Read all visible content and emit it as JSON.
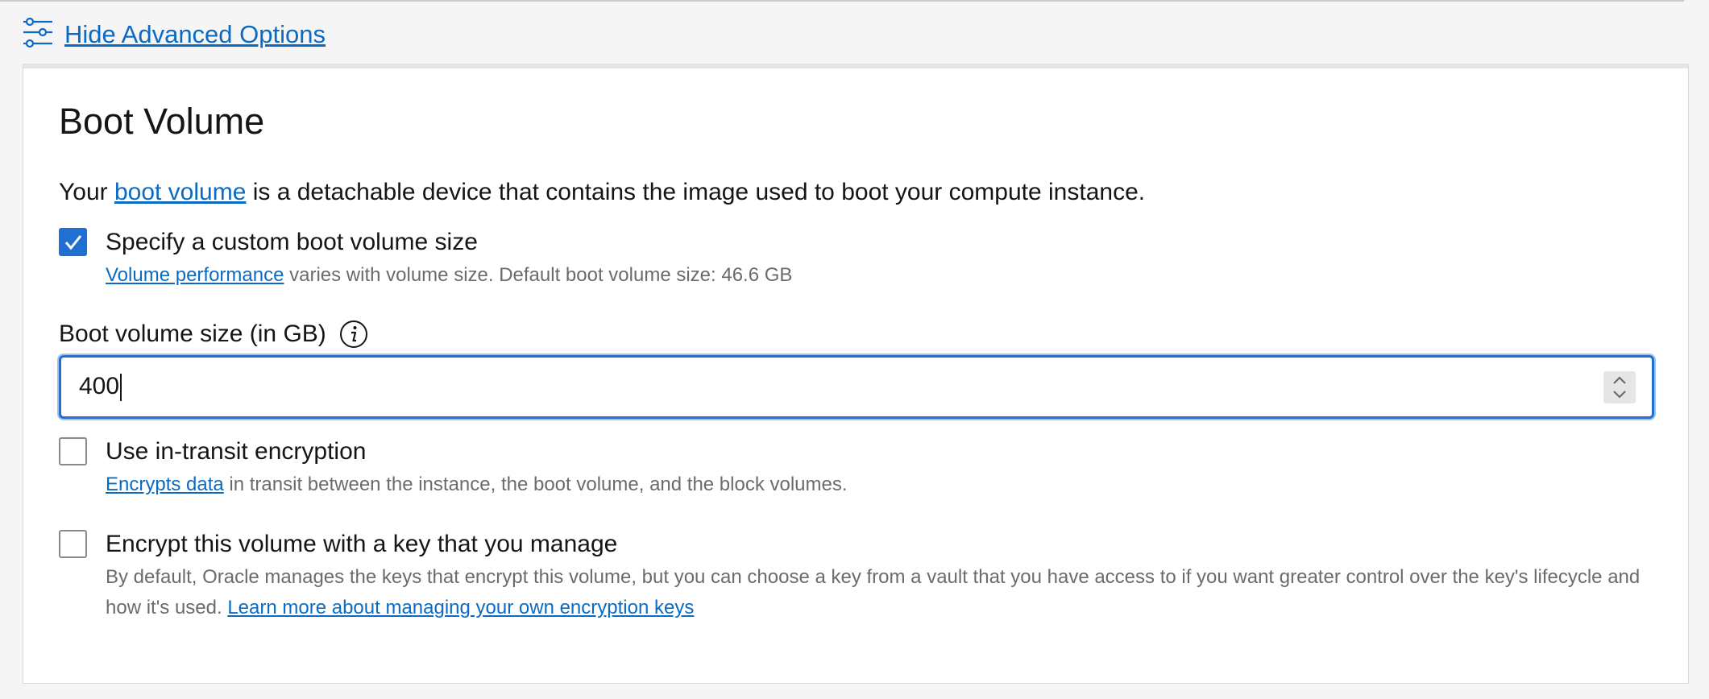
{
  "advanced_toggle": {
    "label": "Hide Advanced Options",
    "icon": "sliders-icon"
  },
  "section": {
    "title": "Boot Volume",
    "description": {
      "prefix": "Your ",
      "link": "boot volume",
      "suffix": " is a detachable device that contains the image used to boot your compute instance."
    }
  },
  "custom_size": {
    "label": "Specify a custom boot volume size",
    "checked": true,
    "help_link": "Volume performance",
    "help_text": " varies with volume size. Default boot volume size: 46.6 GB"
  },
  "size_field": {
    "label": "Boot volume size (in GB)",
    "value": "400",
    "info_icon": "info-icon"
  },
  "in_transit": {
    "label": "Use in-transit encryption",
    "checked": false,
    "help_link": "Encrypts data",
    "help_text": " in transit between the instance, the boot volume, and the block volumes."
  },
  "own_key": {
    "label": "Encrypt this volume with a key that you manage",
    "checked": false,
    "help_text_line1": "By default, Oracle manages the keys that encrypt this volume, but you can choose a key from a vault that you have access to if you want greater control over the key's lifecycle and",
    "help_text_line2": "how it's used. ",
    "help_link": "Learn more about managing your own encryption keys"
  },
  "colors": {
    "accent": "#1f70d1",
    "link": "#0b6bc4",
    "muted": "#6b6b6b"
  }
}
